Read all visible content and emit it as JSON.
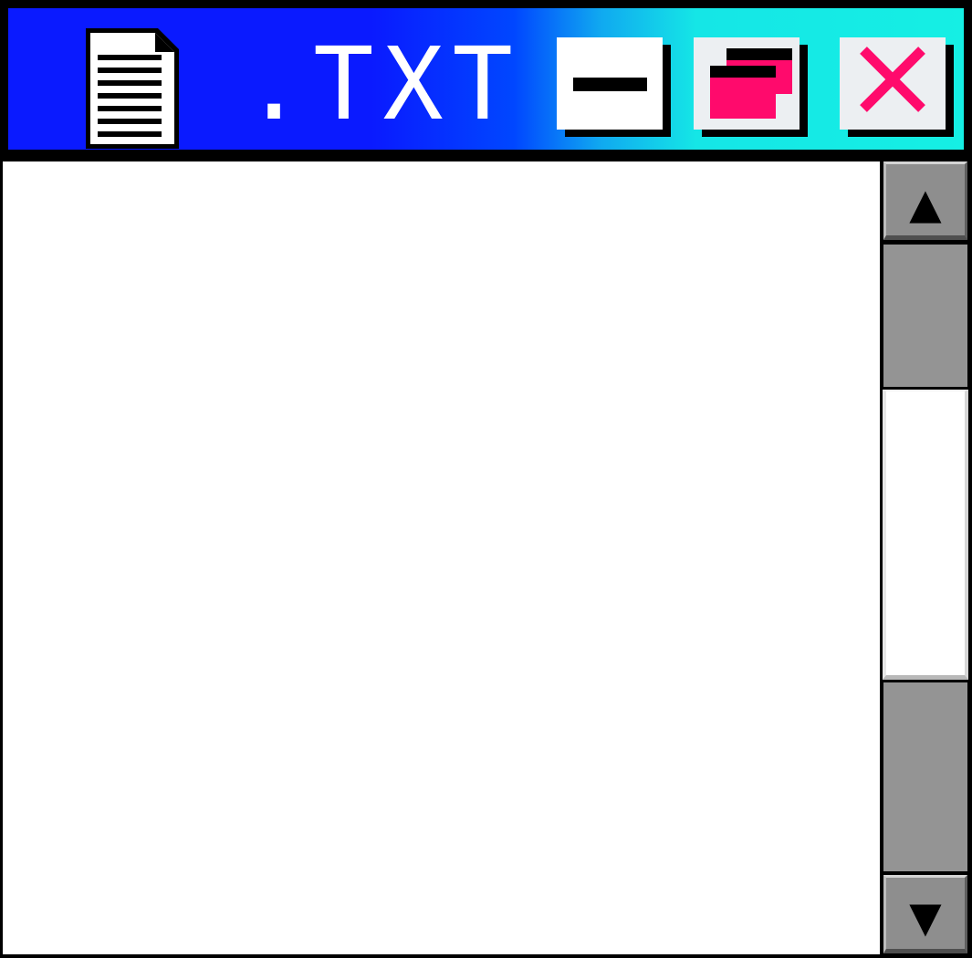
{
  "window": {
    "title": ".TXT",
    "file_icon": "text-document-icon"
  },
  "controls": {
    "minimize_icon": "minimize-icon",
    "maximize_icon": "restore-icon",
    "close_icon": "close-icon",
    "accent_color": "#ff0a6c"
  },
  "titlebar_colors": {
    "start": "#0a1aff",
    "end": "#15efe4"
  },
  "content": {
    "text": ""
  },
  "scrollbar": {
    "up_glyph": "▲",
    "down_glyph": "▼"
  }
}
